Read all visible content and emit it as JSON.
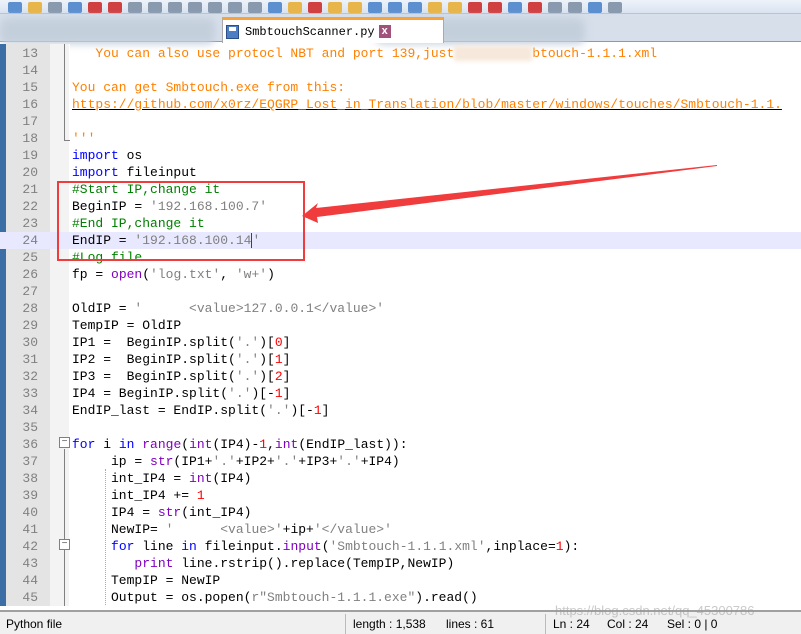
{
  "tab": {
    "filename": "SmbtouchScanner.py",
    "close_glyph": "x"
  },
  "editor": {
    "current_line": 24,
    "lines": [
      {
        "n": "13",
        "t": [
          [
            "d",
            "   You can also use protocl NBT and port 139,just"
          ],
          [
            "bl",
            " modify Sm"
          ],
          [
            "d",
            "btouch-1.1.1.xml"
          ]
        ]
      },
      {
        "n": "14",
        "t": []
      },
      {
        "n": "15",
        "t": [
          [
            "d",
            "You can get Smbtouch.exe from this:"
          ]
        ]
      },
      {
        "n": "16",
        "t": [
          [
            "u",
            "https://github.com/x0rz/EQGRP_Lost_in_Translation/blob/master/windows/touches/Smbtouch-1.1."
          ]
        ]
      },
      {
        "n": "17",
        "t": []
      },
      {
        "n": "18",
        "t": [
          [
            "d",
            "'''"
          ]
        ]
      },
      {
        "n": "19",
        "t": [
          [
            "k",
            "import"
          ],
          [
            "",
            "",
            " os"
          ]
        ]
      },
      {
        "n": "20",
        "t": [
          [
            "k",
            "import"
          ],
          [
            "",
            " fileinput"
          ]
        ]
      },
      {
        "n": "21",
        "t": [
          [
            "c",
            "#Start IP,change it"
          ]
        ]
      },
      {
        "n": "22",
        "t": [
          [
            "",
            "BeginIP = "
          ],
          [
            "s",
            "'192.168.100.7'"
          ]
        ]
      },
      {
        "n": "23",
        "t": [
          [
            "c",
            "#End IP,change it"
          ]
        ]
      },
      {
        "n": "24",
        "t": [
          [
            "",
            "EndIP = "
          ],
          [
            "s",
            "'192.168.100.14"
          ],
          [
            "caret",
            ""
          ],
          [
            "s",
            "'"
          ]
        ]
      },
      {
        "n": "25",
        "t": [
          [
            "c",
            "#Log file"
          ]
        ]
      },
      {
        "n": "26",
        "t": [
          [
            "",
            "fp = "
          ],
          [
            "b",
            "open"
          ],
          [
            "",
            "("
          ],
          [
            "s",
            "'log.txt'"
          ],
          [
            "",
            ", "
          ],
          [
            "s",
            "'w+'"
          ],
          [
            "",
            ")"
          ]
        ]
      },
      {
        "n": "27",
        "t": []
      },
      {
        "n": "28",
        "t": [
          [
            "",
            "OldIP = "
          ],
          [
            "s",
            "'      <value>127.0.0.1</value>'"
          ]
        ]
      },
      {
        "n": "29",
        "t": [
          [
            "",
            "TempIP = OldIP"
          ]
        ]
      },
      {
        "n": "30",
        "t": [
          [
            "",
            "IP1 =  BeginIP.split("
          ],
          [
            "s",
            "'.'"
          ],
          [
            "",
            ")["
          ],
          [
            "n",
            "0"
          ],
          [
            "",
            "]"
          ]
        ]
      },
      {
        "n": "31",
        "t": [
          [
            "",
            "IP2 =  BeginIP.split("
          ],
          [
            "s",
            "'.'"
          ],
          [
            "",
            ")["
          ],
          [
            "n",
            "1"
          ],
          [
            "",
            "]"
          ]
        ]
      },
      {
        "n": "32",
        "t": [
          [
            "",
            "IP3 =  BeginIP.split("
          ],
          [
            "s",
            "'.'"
          ],
          [
            "",
            ")["
          ],
          [
            "n",
            "2"
          ],
          [
            "",
            "]"
          ]
        ]
      },
      {
        "n": "33",
        "t": [
          [
            "",
            "IP4 = BeginIP.split("
          ],
          [
            "s",
            "'.'"
          ],
          [
            "",
            ")[-"
          ],
          [
            "n",
            "1"
          ],
          [
            "",
            "]"
          ]
        ]
      },
      {
        "n": "34",
        "t": [
          [
            "",
            "EndIP_last = EndIP.split("
          ],
          [
            "s",
            "'.'"
          ],
          [
            "",
            ")[-"
          ],
          [
            "n",
            "1"
          ],
          [
            "",
            "]"
          ]
        ]
      },
      {
        "n": "35",
        "t": []
      },
      {
        "n": "36",
        "t": [
          [
            "k",
            "for"
          ],
          [
            "",
            " i "
          ],
          [
            "k",
            "in"
          ],
          [
            " ",
            ""
          ],
          [
            "",
            " "
          ],
          [
            "b",
            "range"
          ],
          [
            "",
            "("
          ],
          [
            "b",
            "int"
          ],
          [
            "",
            "(IP4)-"
          ],
          [
            "n",
            "1"
          ],
          [
            "",
            ","
          ],
          [
            "b",
            "int"
          ],
          [
            "",
            "(EndIP_last)):"
          ]
        ]
      },
      {
        "n": "37",
        "t": [
          [
            "",
            "     ip = "
          ],
          [
            "b",
            "str"
          ],
          [
            "",
            "(IP1+"
          ],
          [
            "s",
            "'.'"
          ],
          [
            "",
            "+IP2+"
          ],
          [
            "s",
            "'.'"
          ],
          [
            "",
            "+IP3+"
          ],
          [
            "s",
            "'.'"
          ],
          [
            "",
            "+IP4)"
          ]
        ]
      },
      {
        "n": "38",
        "t": [
          [
            "",
            "     int_IP4 = "
          ],
          [
            "b",
            "int"
          ],
          [
            "",
            "(IP4)"
          ]
        ]
      },
      {
        "n": "39",
        "t": [
          [
            "",
            "     int_IP4 += "
          ],
          [
            "n",
            "1"
          ]
        ]
      },
      {
        "n": "40",
        "t": [
          [
            "",
            "     IP4 = "
          ],
          [
            "b",
            "str"
          ],
          [
            "",
            "(int_IP4)"
          ]
        ]
      },
      {
        "n": "41",
        "t": [
          [
            "",
            "     NewIP= "
          ],
          [
            "s",
            "'      <value>'"
          ],
          [
            "",
            "+ip+"
          ],
          [
            "s",
            "'</value>'"
          ]
        ]
      },
      {
        "n": "42",
        "t": [
          [
            "",
            "     "
          ],
          [
            "k",
            "for"
          ],
          [
            "",
            " line "
          ],
          [
            "k",
            "in"
          ],
          [
            "",
            " fileinput."
          ],
          [
            "b",
            "input"
          ],
          [
            "",
            "("
          ],
          [
            "s",
            "'Smbtouch-1.1.1.xml'"
          ],
          [
            "",
            ",inplace="
          ],
          [
            "n",
            "1"
          ],
          [
            "",
            "):"
          ]
        ]
      },
      {
        "n": "43",
        "t": [
          [
            "",
            "        "
          ],
          [
            "b",
            "print"
          ],
          [
            "",
            " line.rstrip().replace(TempIP,NewIP)"
          ]
        ]
      },
      {
        "n": "44",
        "t": [
          [
            "",
            "     TempIP = NewIP"
          ]
        ]
      },
      {
        "n": "45",
        "t": [
          [
            "",
            "     Output = os.popen("
          ],
          [
            "s",
            "r\"Smbtouch-1.1.1.exe\""
          ],
          [
            "",
            ").read()"
          ]
        ]
      }
    ]
  },
  "annotation": {
    "color": "#f03c3c"
  },
  "status": {
    "file_type": "Python file",
    "length": "length : 1,538",
    "lines": "lines : 61",
    "ln": "Ln : 24",
    "col": "Col : 24",
    "sel": "Sel : 0 | 0",
    "watermark": "https://blog.csdn.net/qq_45300786"
  }
}
